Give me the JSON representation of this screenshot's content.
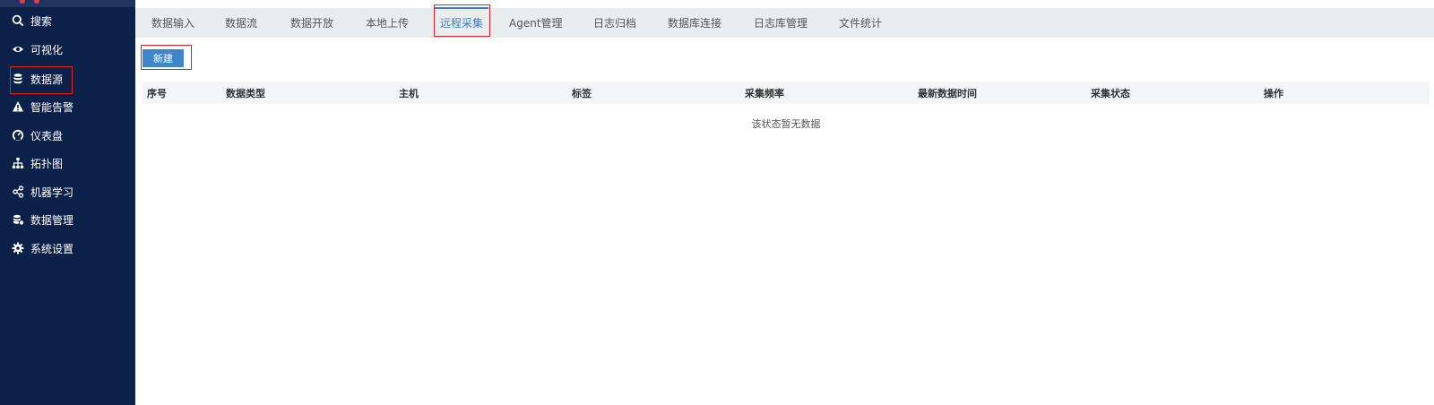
{
  "sidebar": {
    "items": [
      {
        "label": "搜索",
        "icon": "search-icon"
      },
      {
        "label": "可视化",
        "icon": "eye-icon"
      },
      {
        "label": "数据源",
        "icon": "database-icon"
      },
      {
        "label": "智能告警",
        "icon": "warning-icon"
      },
      {
        "label": "仪表盘",
        "icon": "gauge-icon"
      },
      {
        "label": "拓扑图",
        "icon": "sitemap-icon"
      },
      {
        "label": "机器学习",
        "icon": "nodes-icon"
      },
      {
        "label": "数据管理",
        "icon": "data-manage-icon"
      },
      {
        "label": "系统设置",
        "icon": "gear-icon"
      }
    ],
    "selected": "数据源"
  },
  "tabs": [
    {
      "label": "数据输入"
    },
    {
      "label": "数据流"
    },
    {
      "label": "数据开放"
    },
    {
      "label": "本地上传"
    },
    {
      "label": "远程采集"
    },
    {
      "label": "Agent管理"
    },
    {
      "label": "日志归档"
    },
    {
      "label": "数据库连接"
    },
    {
      "label": "日志库管理"
    },
    {
      "label": "文件统计"
    }
  ],
  "active_tab": "远程采集",
  "toolbar": {
    "new_label": "新建"
  },
  "table": {
    "columns": [
      "序号",
      "数据类型",
      "主机",
      "标签",
      "采集频率",
      "最新数据时间",
      "采集状态",
      "操作"
    ],
    "rows": [],
    "empty_text": "该状态暂无数据"
  },
  "colors": {
    "sidebar_bg": "#0c2149",
    "accent": "#3a7fc4",
    "button_bg": "#3c86c9",
    "highlight_border": "#e02020",
    "tabbar_bg": "#e9edf0"
  }
}
